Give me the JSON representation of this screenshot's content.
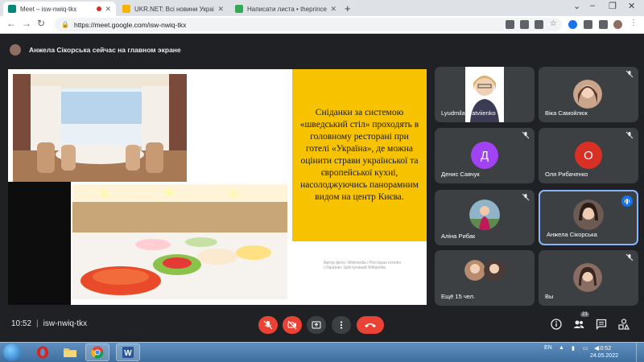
{
  "browser": {
    "tabs": [
      {
        "title": "Meet – isw-nwiq-tkx",
        "favicon_color": "#00897b",
        "active": true,
        "recording": true
      },
      {
        "title": "UKR.NET: Всі новини України, о",
        "favicon_color": "#f4b400",
        "active": false
      },
      {
        "title": "Написати листа • theprincess@",
        "favicon_color": "#34a853",
        "active": false
      }
    ],
    "new_tab_label": "+",
    "url": "https://meet.google.com/isw-nwiq-tkx"
  },
  "meet": {
    "presenter_banner": "Анжела Сікорська сейчас на главном экране",
    "slide": {
      "text": "Сніданки за системою «шведський стіл» проходять в головному ресторані при готелі «Україна», де можна оцінити страви української та європейської кухні, насолоджуючись панорамним видом на центр Києва.",
      "caption": "Автор фото: Wikimedia / Ресторан готелю «Україна» Цей кучаний Wikipedia"
    },
    "participants": [
      {
        "name": "Lyudmila Matviienko",
        "type": "photo",
        "muted": false
      },
      {
        "name": "Віка Самойлюк",
        "type": "photo",
        "muted": true
      },
      {
        "name": "Денис Савчук",
        "type": "letter",
        "letter": "Д",
        "color": "#a142f4",
        "muted": true
      },
      {
        "name": "Оля Рибаченко",
        "type": "letter",
        "letter": "О",
        "color": "#d93025",
        "muted": true
      },
      {
        "name": "Аліна Рибак",
        "type": "photo",
        "muted": true
      },
      {
        "name": "Анжела Сікорська",
        "type": "photo",
        "muted": false,
        "speaking": true
      },
      {
        "name": "Ещё 15 чел.",
        "type": "group",
        "muted": false
      },
      {
        "name": "Вы",
        "type": "photo",
        "muted": true
      }
    ],
    "footer": {
      "time": "10:52",
      "meeting_code": "isw-nwiq-tkx",
      "people_count": "23"
    }
  },
  "taskbar": {
    "language": "EN",
    "clock_time": "10:52",
    "clock_date": "24.05.2022"
  },
  "colors": {
    "accent_red": "#ea4335",
    "slide_yellow": "#f7c200",
    "active_speaker": "#8ab4f8"
  }
}
